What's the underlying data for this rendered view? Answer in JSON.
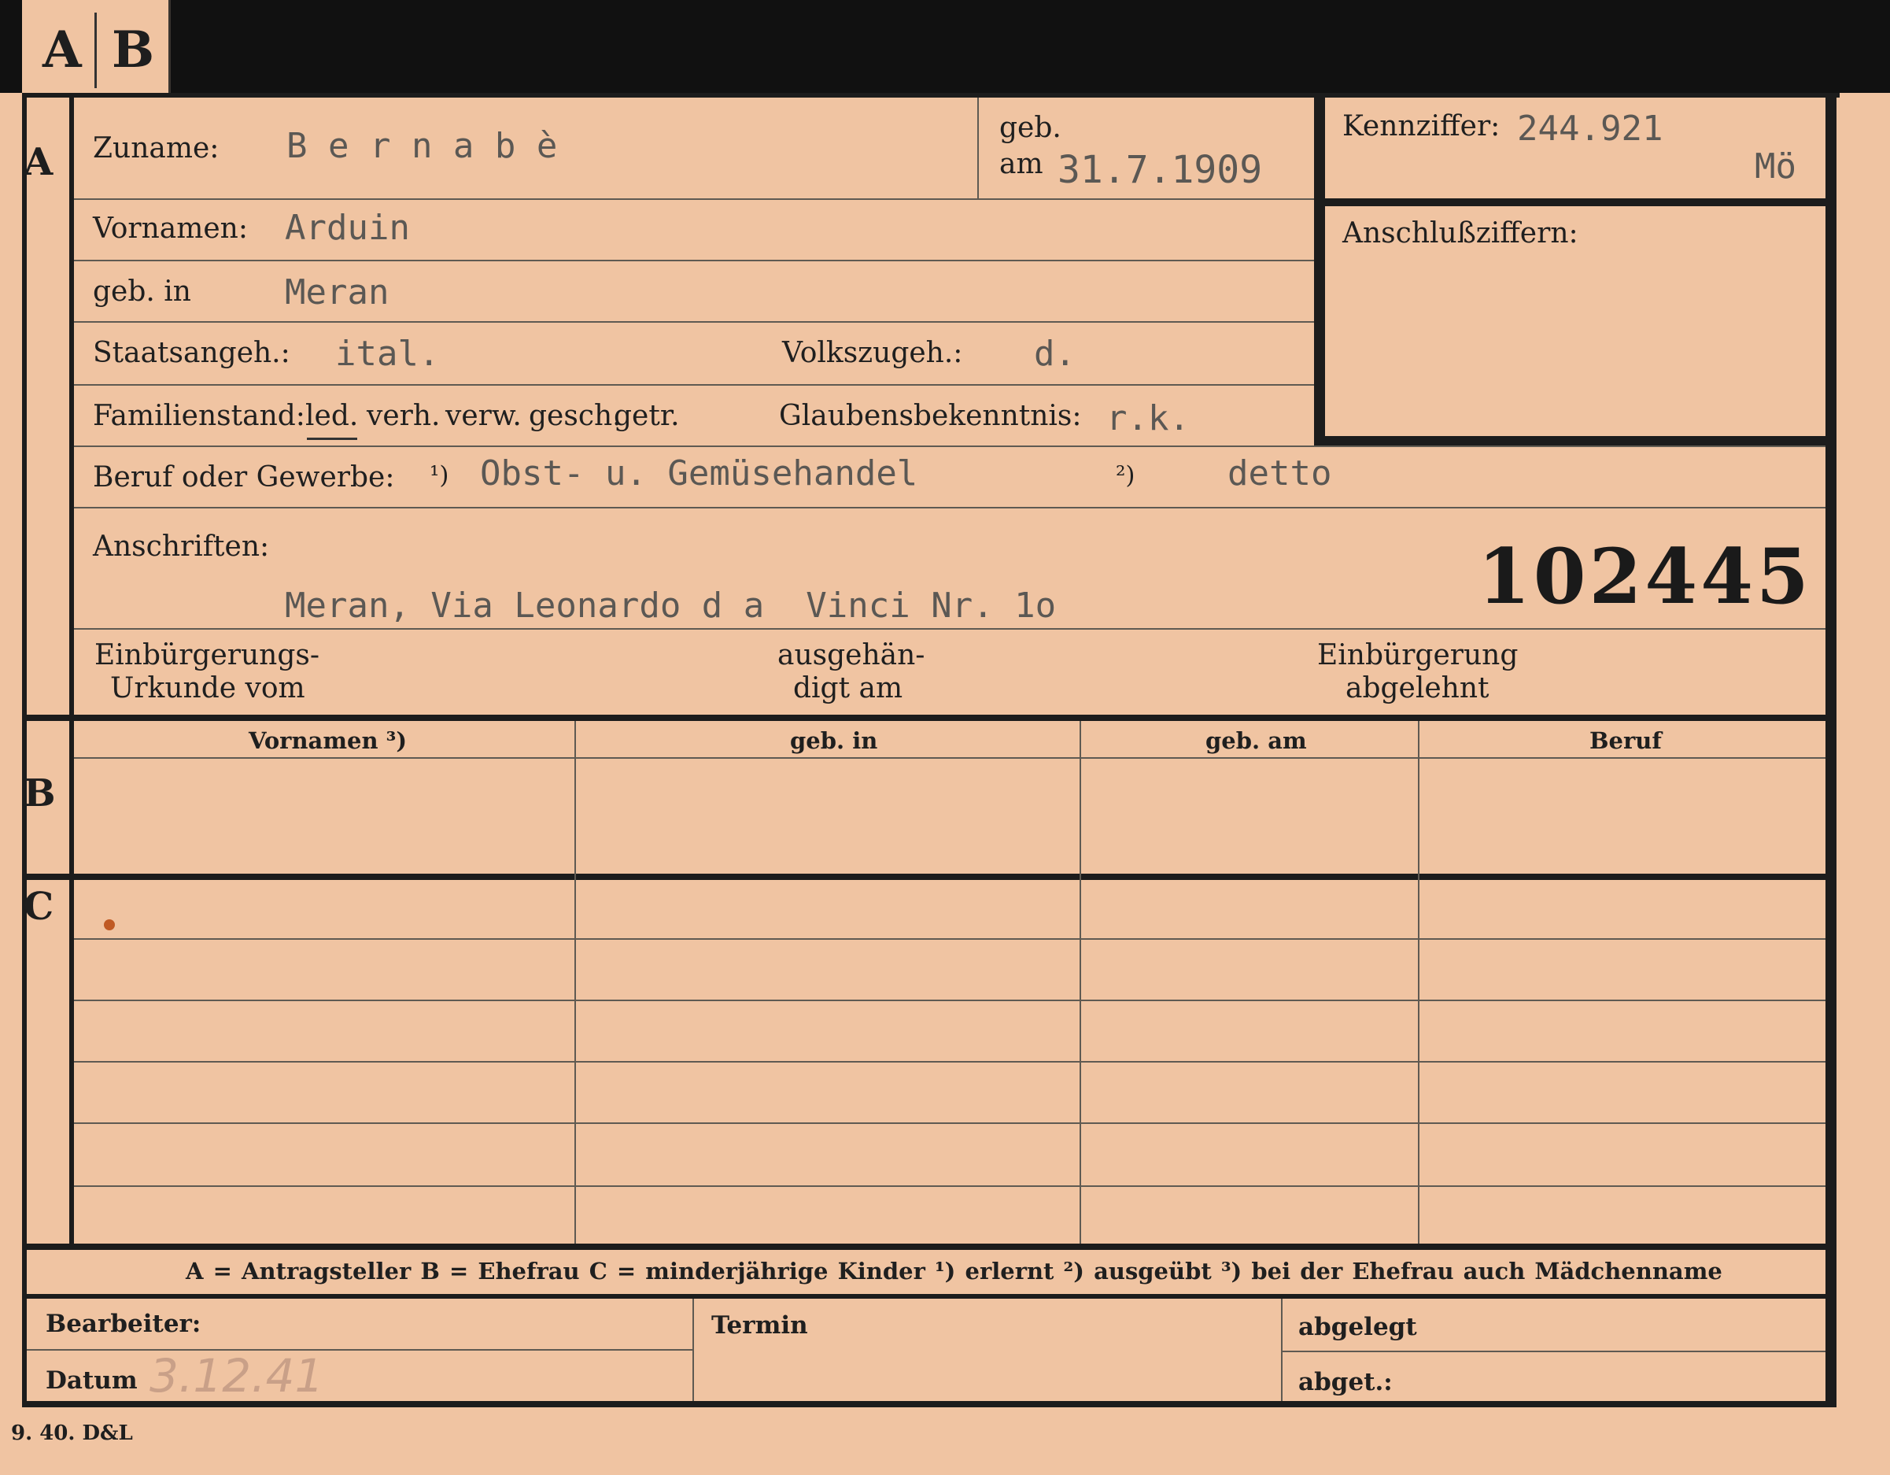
{
  "tabs": {
    "a": "A",
    "b": "B"
  },
  "sections": {
    "a": "A",
    "b": "B",
    "c": "C"
  },
  "fields": {
    "zuname_label": "Zuname:",
    "zuname_value": "B e r n a b è",
    "geb_label": "geb.",
    "am_label": "am",
    "geb_am_value": "31.7.1909",
    "kennziffer_label": "Kennziffer:",
    "kennziffer_value": "244.921",
    "kennziffer_mark": "Mö",
    "anschluss_label": "Anschlußziffern:",
    "vornamen_label": "Vornamen:",
    "vornamen_value": "Arduin",
    "gebin_label": "geb. in",
    "gebin_value": "Meran",
    "staat_label": "Staatsangeh.:",
    "staat_value": "ital.",
    "volks_label": "Volkszugeh.:",
    "volks_value": "d.",
    "familien_label": "Familienstand:",
    "familien_options": [
      "led.",
      "verh.",
      "verw.",
      "gesch.",
      "getr."
    ],
    "glauben_label": "Glaubensbekenntnis:",
    "glauben_value": "r.k.",
    "beruf_label": "Beruf oder Gewerbe:",
    "beruf_mark1": "¹)",
    "beruf_value1": "Obst- u. Gemüsehandel",
    "beruf_mark2": "²)",
    "beruf_value2": "detto",
    "anschriften_label": "Anschriften:",
    "anschriften_value": "Meran, Via Leonardo d a  Vinci Nr. 1o",
    "stamp_number": "102445",
    "einb_urkunde_1": "Einbürgerungs-",
    "einb_urkunde_2": "Urkunde vom",
    "ausgeh_1": "ausgehän-",
    "ausgeh_2": "digt am",
    "einb_abgel_1": "Einbürgerung",
    "einb_abgel_2": "abgelehnt"
  },
  "table": {
    "columns": [
      "Vornamen ³)",
      "geb. in",
      "geb. am",
      "Beruf"
    ]
  },
  "legend": {
    "text": "A = Antragsteller    B = Ehefrau    C = minderjährige Kinder    ¹) erlernt    ²) ausgeübt    ³) bei der Ehefrau auch Mädchenname"
  },
  "footer": {
    "bearbeiter_label": "Bearbeiter:",
    "datum_label": "Datum",
    "datum_value": "3.12.41",
    "termin_label": "Termin",
    "abgelegt_label": "abgelegt",
    "abget_label": "abget.:",
    "print_code": "9. 40. D&L"
  }
}
